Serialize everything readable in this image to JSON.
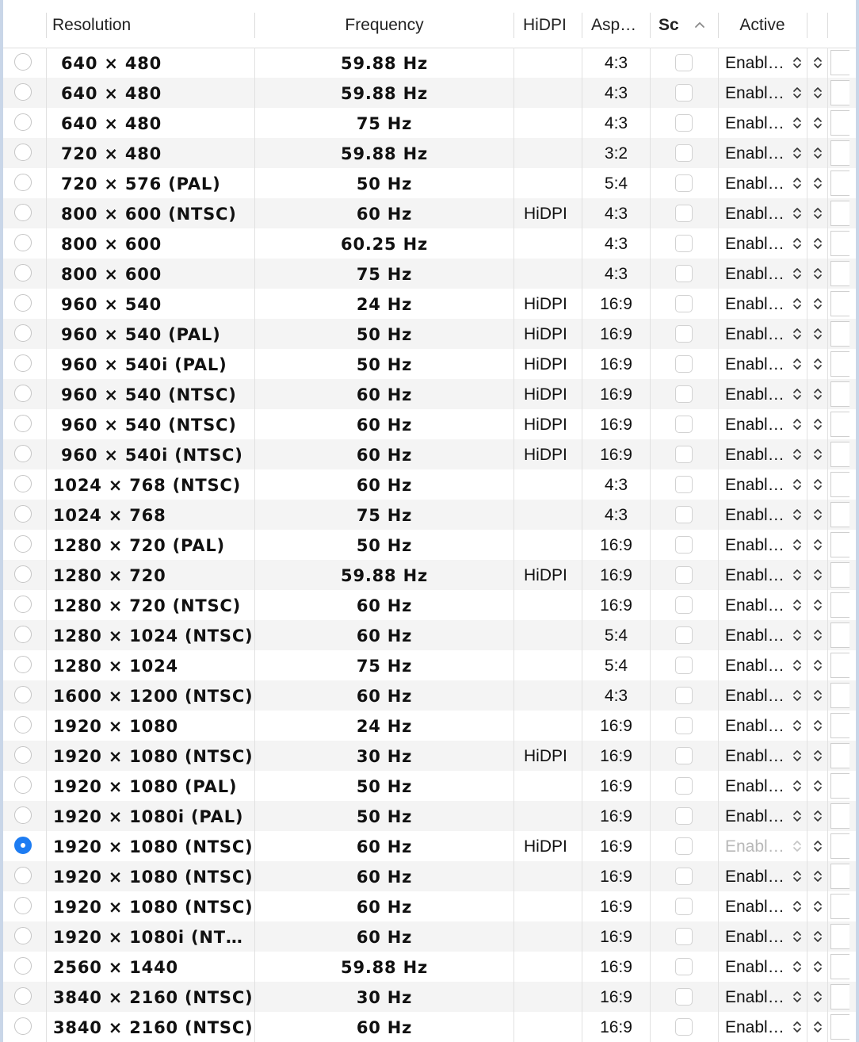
{
  "columns": {
    "resolution": "Resolution",
    "frequency": "Frequency",
    "hidpi": "HiDPI",
    "aspect": "Asp…",
    "scaled": "Sc",
    "active": "Active"
  },
  "active_label": "Enabl…",
  "rows": [
    {
      "resolution": "640 × 480",
      "frequency": "59.88 Hz",
      "hidpi": "",
      "aspect": "4:3",
      "selected": false
    },
    {
      "resolution": "640 × 480",
      "frequency": "59.88 Hz",
      "hidpi": "",
      "aspect": "4:3",
      "selected": false
    },
    {
      "resolution": "640 × 480",
      "frequency": "75 Hz",
      "hidpi": "",
      "aspect": "4:3",
      "selected": false
    },
    {
      "resolution": "720 × 480",
      "frequency": "59.88 Hz",
      "hidpi": "",
      "aspect": "3:2",
      "selected": false
    },
    {
      "resolution": "720 × 576 (PAL)",
      "frequency": "50 Hz",
      "hidpi": "",
      "aspect": "5:4",
      "selected": false
    },
    {
      "resolution": "800 × 600 (NTSC)",
      "frequency": "60 Hz",
      "hidpi": "HiDPI",
      "aspect": "4:3",
      "selected": false
    },
    {
      "resolution": "800 × 600",
      "frequency": "60.25 Hz",
      "hidpi": "",
      "aspect": "4:3",
      "selected": false
    },
    {
      "resolution": "800 × 600",
      "frequency": "75 Hz",
      "hidpi": "",
      "aspect": "4:3",
      "selected": false
    },
    {
      "resolution": "960 × 540",
      "frequency": "24 Hz",
      "hidpi": "HiDPI",
      "aspect": "16:9",
      "selected": false
    },
    {
      "resolution": "960 × 540 (PAL)",
      "frequency": "50 Hz",
      "hidpi": "HiDPI",
      "aspect": "16:9",
      "selected": false
    },
    {
      "resolution": "960 × 540i (PAL)",
      "frequency": "50 Hz",
      "hidpi": "HiDPI",
      "aspect": "16:9",
      "selected": false
    },
    {
      "resolution": "960 × 540 (NTSC)",
      "frequency": "60 Hz",
      "hidpi": "HiDPI",
      "aspect": "16:9",
      "selected": false
    },
    {
      "resolution": "960 × 540 (NTSC)",
      "frequency": "60 Hz",
      "hidpi": "HiDPI",
      "aspect": "16:9",
      "selected": false
    },
    {
      "resolution": "960 × 540i (NTSC)",
      "frequency": "60 Hz",
      "hidpi": "HiDPI",
      "aspect": "16:9",
      "selected": false
    },
    {
      "resolution": "1024 × 768 (NTSC)",
      "frequency": "60 Hz",
      "hidpi": "",
      "aspect": "4:3",
      "selected": false
    },
    {
      "resolution": "1024 × 768",
      "frequency": "75 Hz",
      "hidpi": "",
      "aspect": "4:3",
      "selected": false
    },
    {
      "resolution": "1280 × 720 (PAL)",
      "frequency": "50 Hz",
      "hidpi": "",
      "aspect": "16:9",
      "selected": false
    },
    {
      "resolution": "1280 × 720",
      "frequency": "59.88 Hz",
      "hidpi": "HiDPI",
      "aspect": "16:9",
      "selected": false
    },
    {
      "resolution": "1280 × 720 (NTSC)",
      "frequency": "60 Hz",
      "hidpi": "",
      "aspect": "16:9",
      "selected": false
    },
    {
      "resolution": "1280 × 1024 (NTSC)",
      "frequency": "60 Hz",
      "hidpi": "",
      "aspect": "5:4",
      "selected": false
    },
    {
      "resolution": "1280 × 1024",
      "frequency": "75 Hz",
      "hidpi": "",
      "aspect": "5:4",
      "selected": false
    },
    {
      "resolution": "1600 × 1200 (NTSC)",
      "frequency": "60 Hz",
      "hidpi": "",
      "aspect": "4:3",
      "selected": false
    },
    {
      "resolution": "1920 × 1080",
      "frequency": "24 Hz",
      "hidpi": "",
      "aspect": "16:9",
      "selected": false
    },
    {
      "resolution": "1920 × 1080 (NTSC)",
      "frequency": "30 Hz",
      "hidpi": "HiDPI",
      "aspect": "16:9",
      "selected": false
    },
    {
      "resolution": "1920 × 1080 (PAL)",
      "frequency": "50 Hz",
      "hidpi": "",
      "aspect": "16:9",
      "selected": false
    },
    {
      "resolution": "1920 × 1080i (PAL)",
      "frequency": "50 Hz",
      "hidpi": "",
      "aspect": "16:9",
      "selected": false
    },
    {
      "resolution": "1920 × 1080 (NTSC)",
      "frequency": "60 Hz",
      "hidpi": "HiDPI",
      "aspect": "16:9",
      "selected": true
    },
    {
      "resolution": "1920 × 1080 (NTSC)",
      "frequency": "60 Hz",
      "hidpi": "",
      "aspect": "16:9",
      "selected": false
    },
    {
      "resolution": "1920 × 1080 (NTSC)",
      "frequency": "60 Hz",
      "hidpi": "",
      "aspect": "16:9",
      "selected": false
    },
    {
      "resolution": "1920 × 1080i (NT…",
      "frequency": "60 Hz",
      "hidpi": "",
      "aspect": "16:9",
      "selected": false
    },
    {
      "resolution": "2560 × 1440",
      "frequency": "59.88 Hz",
      "hidpi": "",
      "aspect": "16:9",
      "selected": false
    },
    {
      "resolution": "3840 × 2160 (NTSC)",
      "frequency": "30 Hz",
      "hidpi": "",
      "aspect": "16:9",
      "selected": false
    },
    {
      "resolution": "3840 × 2160 (NTSC)",
      "frequency": "60 Hz",
      "hidpi": "",
      "aspect": "16:9",
      "selected": false
    }
  ]
}
